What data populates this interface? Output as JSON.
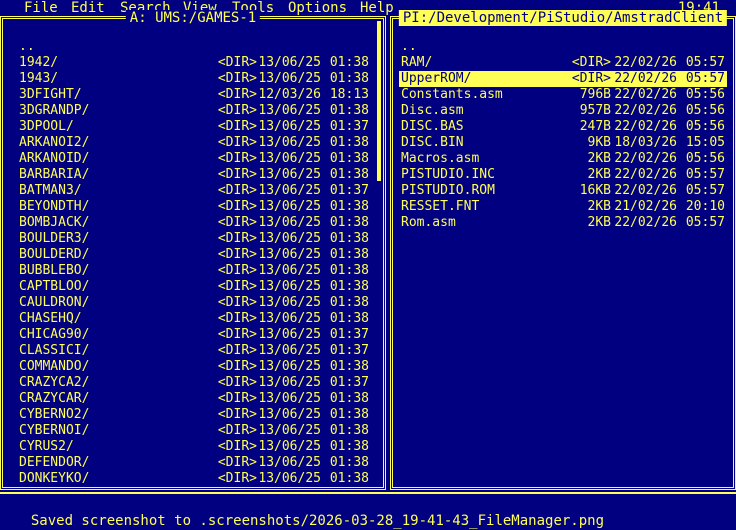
{
  "menu": {
    "items": [
      "File",
      "Edit",
      "Search",
      "View",
      "Tools",
      "Options",
      "Help"
    ],
    "clock": "19:41"
  },
  "left_panel": {
    "title": "A: UMS:/GAMES-1",
    "rows": [
      {
        "name": "..",
        "size": "",
        "date": "",
        "time": ""
      },
      {
        "name": "1942/",
        "size": "<DIR>",
        "date": "13/06/25",
        "time": "01:38"
      },
      {
        "name": "1943/",
        "size": "<DIR>",
        "date": "13/06/25",
        "time": "01:38"
      },
      {
        "name": "3DFIGHT/",
        "size": "<DIR>",
        "date": "12/03/26",
        "time": "18:13"
      },
      {
        "name": "3DGRANDP/",
        "size": "<DIR>",
        "date": "13/06/25",
        "time": "01:38"
      },
      {
        "name": "3DPOOL/",
        "size": "<DIR>",
        "date": "13/06/25",
        "time": "01:37"
      },
      {
        "name": "ARKANOI2/",
        "size": "<DIR>",
        "date": "13/06/25",
        "time": "01:38"
      },
      {
        "name": "ARKANOID/",
        "size": "<DIR>",
        "date": "13/06/25",
        "time": "01:38"
      },
      {
        "name": "BARBARIA/",
        "size": "<DIR>",
        "date": "13/06/25",
        "time": "01:38"
      },
      {
        "name": "BATMAN3/",
        "size": "<DIR>",
        "date": "13/06/25",
        "time": "01:37"
      },
      {
        "name": "BEYONDTH/",
        "size": "<DIR>",
        "date": "13/06/25",
        "time": "01:38"
      },
      {
        "name": "BOMBJACK/",
        "size": "<DIR>",
        "date": "13/06/25",
        "time": "01:38"
      },
      {
        "name": "BOULDER3/",
        "size": "<DIR>",
        "date": "13/06/25",
        "time": "01:38"
      },
      {
        "name": "BOULDERD/",
        "size": "<DIR>",
        "date": "13/06/25",
        "time": "01:38"
      },
      {
        "name": "BUBBLEBO/",
        "size": "<DIR>",
        "date": "13/06/25",
        "time": "01:38"
      },
      {
        "name": "CAPTBLOO/",
        "size": "<DIR>",
        "date": "13/06/25",
        "time": "01:38"
      },
      {
        "name": "CAULDRON/",
        "size": "<DIR>",
        "date": "13/06/25",
        "time": "01:38"
      },
      {
        "name": "CHASEHQ/",
        "size": "<DIR>",
        "date": "13/06/25",
        "time": "01:38"
      },
      {
        "name": "CHICAG90/",
        "size": "<DIR>",
        "date": "13/06/25",
        "time": "01:37"
      },
      {
        "name": "CLASSICI/",
        "size": "<DIR>",
        "date": "13/06/25",
        "time": "01:37"
      },
      {
        "name": "COMMANDO/",
        "size": "<DIR>",
        "date": "13/06/25",
        "time": "01:38"
      },
      {
        "name": "CRAZYCA2/",
        "size": "<DIR>",
        "date": "13/06/25",
        "time": "01:37"
      },
      {
        "name": "CRAZYCAR/",
        "size": "<DIR>",
        "date": "13/06/25",
        "time": "01:38"
      },
      {
        "name": "CYBERNO2/",
        "size": "<DIR>",
        "date": "13/06/25",
        "time": "01:38"
      },
      {
        "name": "CYBERNOI/",
        "size": "<DIR>",
        "date": "13/06/25",
        "time": "01:38"
      },
      {
        "name": "CYRUS2/",
        "size": "<DIR>",
        "date": "13/06/25",
        "time": "01:38"
      },
      {
        "name": "DEFENDOR/",
        "size": "<DIR>",
        "date": "13/06/25",
        "time": "01:38"
      },
      {
        "name": "DONKEYKO/",
        "size": "<DIR>",
        "date": "13/06/25",
        "time": "01:38"
      }
    ]
  },
  "right_panel": {
    "title": "PI:/Development/PiStudio/AmstradClient",
    "selected_index": 2,
    "rows": [
      {
        "name": "..",
        "size": "",
        "date": "",
        "time": ""
      },
      {
        "name": "RAM/",
        "size": "<DIR>",
        "date": "22/02/26",
        "time": "05:57"
      },
      {
        "name": "UpperROM/",
        "size": "<DIR>",
        "date": "22/02/26",
        "time": "05:57"
      },
      {
        "name": "Constants.asm",
        "size": "796B",
        "date": "22/02/26",
        "time": "05:56"
      },
      {
        "name": "Disc.asm",
        "size": "957B",
        "date": "22/02/26",
        "time": "05:56"
      },
      {
        "name": "DISC.BAS",
        "size": "247B",
        "date": "22/02/26",
        "time": "05:56"
      },
      {
        "name": "DISC.BIN",
        "size": "9KB",
        "date": "18/03/26",
        "time": "15:05"
      },
      {
        "name": "Macros.asm",
        "size": "2KB",
        "date": "22/02/26",
        "time": "05:56"
      },
      {
        "name": "PISTUDIO.INC",
        "size": "2KB",
        "date": "22/02/26",
        "time": "05:57"
      },
      {
        "name": "PISTUDIO.ROM",
        "size": "16KB",
        "date": "22/02/26",
        "time": "05:57"
      },
      {
        "name": "RESSET.FNT",
        "size": "2KB",
        "date": "21/02/26",
        "time": "20:10"
      },
      {
        "name": "Rom.asm",
        "size": "2KB",
        "date": "22/02/26",
        "time": "05:57"
      }
    ]
  },
  "status": {
    "message": "Saved screenshot to .screenshots/2026-03-28_19-41-43_FileManager.png"
  },
  "colors": {
    "background": "#000080",
    "foreground": "#ffff55"
  }
}
